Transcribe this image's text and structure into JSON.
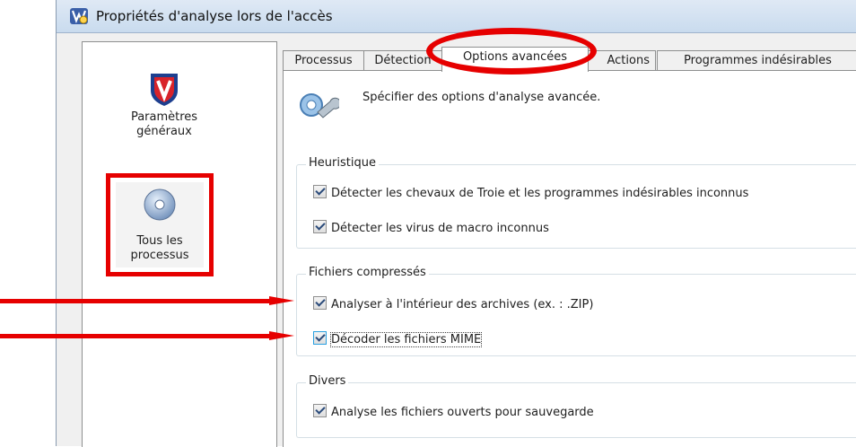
{
  "window": {
    "title": "Propriétés d'analyse lors de l'accès"
  },
  "sidebar": {
    "items": [
      {
        "line1": "Paramètres",
        "line2": "généraux",
        "icon": "mcafee-shield-icon"
      },
      {
        "line1": "Tous les",
        "line2": "processus",
        "icon": "process-disc-icon"
      }
    ]
  },
  "tabs": [
    {
      "label": "Processus"
    },
    {
      "label": "Détection"
    },
    {
      "label": "Options avancées",
      "active": true
    },
    {
      "label": "Actions"
    },
    {
      "label": "Programmes indésirables"
    }
  ],
  "panel": {
    "intro": "Spécifier des options d'analyse avancée.",
    "groups": [
      {
        "title": "Heuristique",
        "options": [
          {
            "label": "Détecter les chevaux de Troie et les programmes indésirables inconnus",
            "checked": true
          },
          {
            "label": "Détecter les virus de macro inconnus",
            "checked": true
          }
        ]
      },
      {
        "title": "Fichiers compressés",
        "options": [
          {
            "label": "Analyser à l'intérieur des archives (ex. : .ZIP)",
            "checked": true
          },
          {
            "label": "Décoder les fichiers MIME",
            "checked": true
          }
        ]
      },
      {
        "title": "Divers",
        "options": [
          {
            "label": "Analyse les fichiers ouverts pour sauvegarde",
            "checked": true
          }
        ]
      }
    ]
  },
  "colors": {
    "annotation": "#e60000",
    "titlebar": "#c9dbee"
  }
}
